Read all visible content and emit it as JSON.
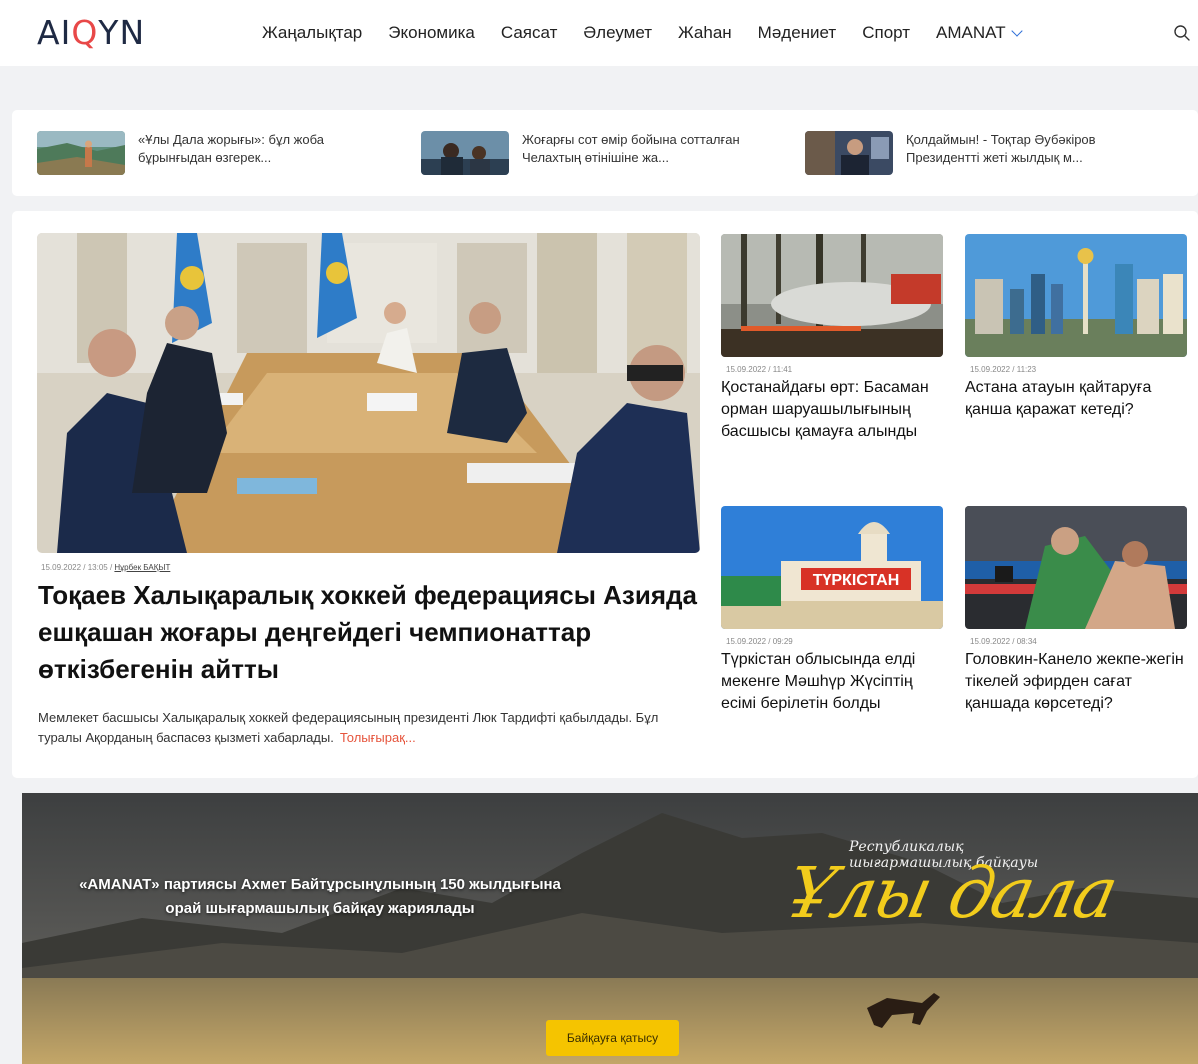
{
  "header": {
    "logo": {
      "left": "AI",
      "accent": "Q",
      "right": "YN"
    },
    "nav": [
      {
        "label": "Жаңалықтар"
      },
      {
        "label": "Экономика"
      },
      {
        "label": "Саясат"
      },
      {
        "label": "Әлеумет"
      },
      {
        "label": "Жаһан"
      },
      {
        "label": "Мәдениет"
      },
      {
        "label": "Спорт"
      },
      {
        "label": "AMANAT",
        "dropdown": true
      }
    ],
    "search_icon": "search-icon"
  },
  "top_strip": [
    {
      "title": "«Ұлы Дала жорығы»: бұл жоба бұрынғыдан өзгерек..."
    },
    {
      "title": "Жоғарғы сот өмір бойына сотталған Челахтың өтінішіне жа..."
    },
    {
      "title": "Қолдаймын! - Тоқтар Әубәкіров Президентті жеті жылдық м..."
    }
  ],
  "hero": {
    "date": "15.09.2022 / 13:05 / ",
    "author": "Нұрбек БАҚЫТ",
    "title": "Тоқаев Халықаралық хоккей федерациясы Азияда ешқашан жоғары деңгейдегі чемпионаттар өткізбегенін айтты",
    "lead": "Мемлекет басшысы Халықаралық хоккей федерациясының президенті Люк Тардифті қабылдады. Бұл туралы Ақорданың баспасөз қызметі хабарлады.",
    "more": "Толығырақ..."
  },
  "cards": [
    {
      "date": "15.09.2022 / 11:41",
      "title": "Қостанайдағы өрт: Басаман орман шаруашылығының басшысы қамауға алынды"
    },
    {
      "date": "15.09.2022 / 11:23",
      "title": "Астана атауын қайтаруға қанша қаражат кетеді?"
    },
    {
      "date": "15.09.2022 / 09:29",
      "title": "Түркістан облысында елді мекенге Мәшһүр Жүсіптің есімі берілетін болды"
    },
    {
      "date": "15.09.2022 / 08:34",
      "title": "Головкин-Канело жекпе-жегін тікелей эфирден сағат қаншада көрсетеді?"
    }
  ],
  "banner": {
    "text": "«AMANAT» партиясы Ахмет Байтұрсынұлының 150 жылдығына орай шығармашылық байқау жариялады",
    "subtitle": "Республикалық шығармашылық байқауы",
    "logo": "Ұлы дала",
    "button": "Байқауға қатысу"
  },
  "colors": {
    "accent": "#e84848",
    "more_link": "#e6553d",
    "banner_button": "#f5c400",
    "logo_yellow": "#f2cc1c"
  }
}
